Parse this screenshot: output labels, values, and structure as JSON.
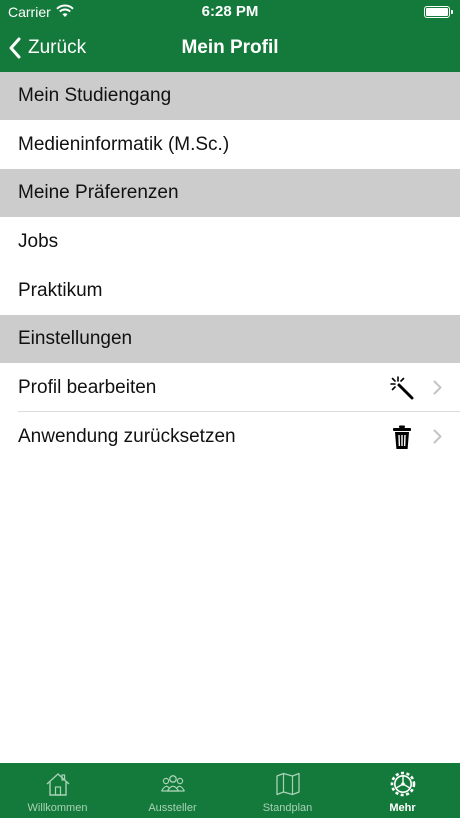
{
  "status_bar": {
    "carrier": "Carrier",
    "time": "6:28 PM"
  },
  "navbar": {
    "back_label": "Zurück",
    "title": "Mein Profil"
  },
  "sections": {
    "studiengang": {
      "header": "Mein Studiengang",
      "items": [
        "Medieninformatik (M.Sc.)"
      ]
    },
    "praeferenzen": {
      "header": "Meine Präferenzen",
      "items": [
        "Jobs",
        "Praktikum"
      ]
    },
    "einstellungen": {
      "header": "Einstellungen",
      "items": [
        {
          "label": "Profil bearbeiten",
          "icon": "magic-wand-icon"
        },
        {
          "label": "Anwendung zurücksetzen",
          "icon": "trash-icon"
        }
      ]
    }
  },
  "tabbar": {
    "tabs": [
      {
        "label": "Willkommen",
        "icon": "home-icon"
      },
      {
        "label": "Aussteller",
        "icon": "people-icon"
      },
      {
        "label": "Standplan",
        "icon": "map-icon"
      },
      {
        "label": "Mehr",
        "icon": "gear-icon",
        "active": true
      }
    ]
  },
  "colors": {
    "brand_green": "#147a3b",
    "section_gray": "#cccccc",
    "inactive_tab": "#a8d1b5"
  }
}
